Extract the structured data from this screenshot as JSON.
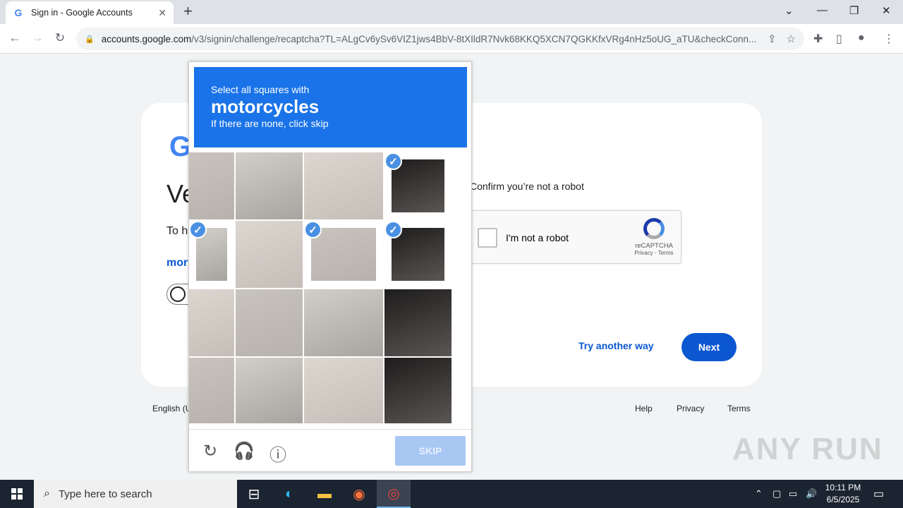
{
  "browser": {
    "tab_title": "Sign in - Google Accounts",
    "tab_favicon": "G",
    "url_host": "accounts.google.com",
    "url_path": "/v3/signin/challenge/recaptcha?TL=ALgCv6ySv6VIZ1jws4BbV-8tXIldR7Nvk68KKQ5XCN7QGKKfxVRg4nHz5oUG_aTU&checkConn..."
  },
  "signin": {
    "heading_fragment": "Ve",
    "body_fragment": "To h mak",
    "link_fragment": "mor",
    "confirm_text": "Confirm you’re not a robot",
    "recaptcha_label": "I'm not a robot",
    "recaptcha_brand": "reCAPTCHA",
    "recaptcha_links": "Privacy - Terms",
    "try_another": "Try another way",
    "next": "Next"
  },
  "footer": {
    "language": "English (U",
    "help": "Help",
    "privacy": "Privacy",
    "terms": "Terms"
  },
  "captcha": {
    "line1": "Select all squares with",
    "keyword": "motorcycles",
    "line3": "If there are none, click skip",
    "skip": "SKIP",
    "selected_tiles": [
      4,
      5,
      7,
      8
    ]
  },
  "watermark": "ANY RUN",
  "taskbar": {
    "search_placeholder": "Type here to search",
    "time": "10:11 PM",
    "date": "6/5/2025"
  }
}
